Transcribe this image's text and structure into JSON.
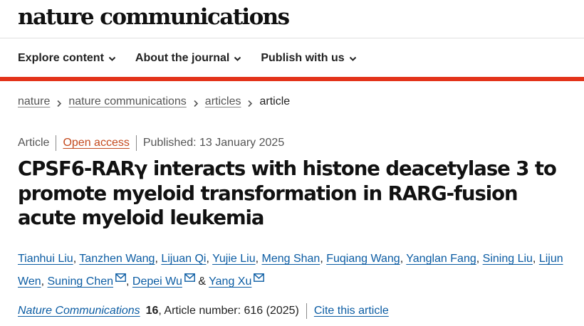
{
  "site": {
    "brand": "nature communications"
  },
  "nav": {
    "items": [
      {
        "label": "Explore content"
      },
      {
        "label": "About the journal"
      },
      {
        "label": "Publish with us"
      }
    ]
  },
  "breadcrumb": {
    "items": [
      "nature",
      "nature communications",
      "articles"
    ],
    "current": "article"
  },
  "meta": {
    "type": "Article",
    "access": "Open access",
    "published": "Published: 13 January 2025"
  },
  "title": "CPSF6-RARγ interacts with histone deacetylase 3 to promote myeloid transformation in RARG-fusion acute myeloid leukemia",
  "authors": [
    {
      "name": "Tianhui Liu"
    },
    {
      "name": "Tanzhen Wang"
    },
    {
      "name": "Lijuan Qi"
    },
    {
      "name": "Yujie Liu"
    },
    {
      "name": "Meng Shan"
    },
    {
      "name": "Fuqiang Wang"
    },
    {
      "name": "Yanglan Fang"
    },
    {
      "name": "Sining Liu"
    },
    {
      "name": "Lijun Wen"
    },
    {
      "name": "Suning Chen"
    },
    {
      "name": "Depei Wu"
    },
    {
      "name": "Yang Xu"
    }
  ],
  "citation": {
    "journal": "Nature Communications",
    "volume": "16",
    "rest": ", Article number: 616 (2025)",
    "cite_link": "Cite this article"
  },
  "colors": {
    "accent_red": "#e3331a",
    "link_blue": "#0b5ca3",
    "open_access": "#c4491d"
  }
}
